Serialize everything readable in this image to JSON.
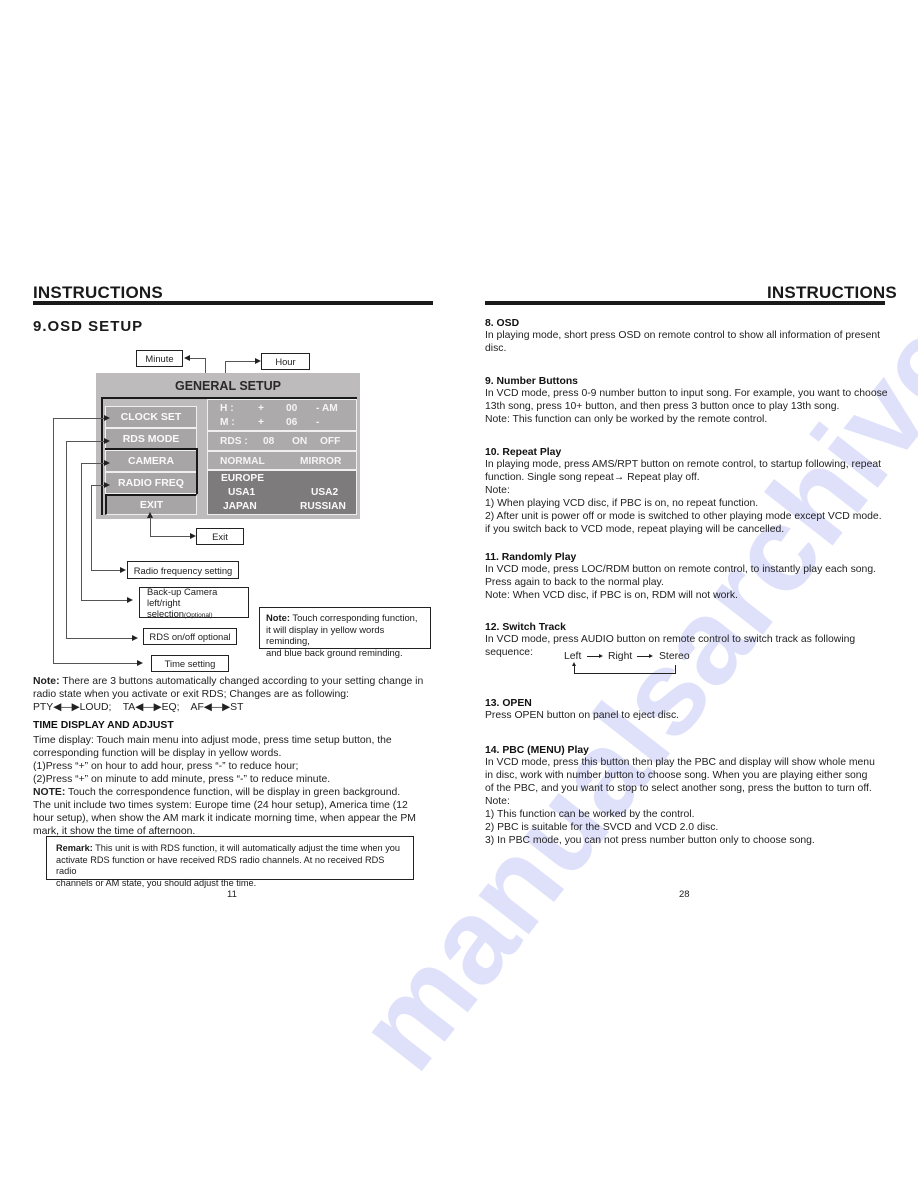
{
  "left_page": {
    "header": "INSTRUCTIONS",
    "section_title": "9.OSD SETUP",
    "diagram": {
      "callouts": {
        "minute": "Minute",
        "hour": "Hour",
        "exit": "Exit",
        "radio_freq": "Radio frequency setting",
        "camera_line1": "Back-up Camera",
        "camera_line2": "left/right selection",
        "camera_optional": "(Optional)",
        "rds": "RDS on/off optional",
        "time": "Time setting"
      },
      "osd": {
        "title": "GENERAL SETUP",
        "menu": [
          "CLOCK SET",
          "RDS MODE",
          "CAMERA",
          "RADIO FREQ",
          "EXIT"
        ],
        "clock": {
          "h_label": "H :",
          "h_plus": "+",
          "h_value": "00",
          "h_ampm": "- AM",
          "m_label": "M :",
          "m_plus": "+",
          "m_value": "06",
          "m_minus": "-"
        },
        "rds": {
          "label": "RDS :",
          "value": "08",
          "on": "ON",
          "off": "OFF"
        },
        "camera": {
          "normal": "NORMAL",
          "mirror": "MIRROR"
        },
        "radio": {
          "europe": "EUROPE",
          "usa1": "USA1",
          "usa2": "USA2",
          "japan": "JAPAN",
          "russian": "RUSSIAN"
        }
      },
      "note_box": {
        "label": "Note:",
        "text1": " Touch corresponding function,",
        "text2": "it will display in yellow words reminding,",
        "text3": "and blue back ground reminding."
      }
    },
    "note": {
      "label": "Note:",
      "text": " There are 3 buttons automatically changed according to your setting change in radio state when you activate or exit RDS; Changes are as following:",
      "pairs": [
        {
          "a": "PTY",
          "b": "LOUD;"
        },
        {
          "a": "TA",
          "b": "EQ;"
        },
        {
          "a": "AF",
          "b": "ST"
        }
      ]
    },
    "time_section": {
      "title": "TIME DISPLAY AND ADJUST",
      "lines": [
        "Time display: Touch main menu into adjust mode, press time setup button, the",
        "corresponding function will be display in yellow words.",
        "(1)Press “+” on hour to add hour, press “-” to reduce hour;",
        "(2)Press “+” on minute to add minute, press “-” to reduce minute."
      ],
      "note_label": "NOTE:",
      "note_text": " Touch the correspondence function, will be display in green background.",
      "tail_lines": [
        "The unit include two times system: Europe time (24 hour setup), America time (12",
        "hour setup), when show the AM mark it indicate morning time, when appear the PM",
        "mark, it show the time of afternoon."
      ]
    },
    "remark": {
      "label": "Remark:",
      "line1": " This unit is with RDS function, it will automatically adjust the time when you",
      "line2": "activate RDS function or have received RDS radio channels. At no received RDS radio",
      "line3": "channels or AM state, you should adjust the time."
    },
    "page_number": "11"
  },
  "right_page": {
    "header": "INSTRUCTIONS",
    "sections": [
      {
        "title": "8. OSD",
        "lines": [
          "In playing mode, short press OSD on remote control to show all information of present",
          "disc."
        ]
      },
      {
        "title": "9. Number Buttons",
        "lines": [
          "In VCD mode, press 0-9 number button to input song. For example, you want to choose",
          "13th  song, press 10+ button, and then press 3 button once to play 13th  song.",
          "Note: This function can only be worked by the remote control."
        ]
      },
      {
        "title": "10. Repeat Play",
        "lines": [
          "In playing mode, press AMS/RPT button on remote control, to startup following, repeat",
          "function.  Single song repeat→ Repeat play off.",
          "Note:",
          "1) When playing VCD disc, if PBC is on, no repeat function.",
          "2) After unit is power off or mode is switched to other playing mode except VCD mode.",
          "if you switch back to VCD mode, repeat playing will be cancelled."
        ]
      },
      {
        "title": "11. Randomly Play",
        "lines": [
          "In VCD mode, press LOC/RDM button on remote control, to instantly play each song.",
          "Press again to back to the normal play.",
          "Note: When VCD disc, if PBC is on, RDM will not work."
        ]
      },
      {
        "title": "12. Switch Track",
        "lines": [
          "In VCD mode, press AUDIO button on remote control to switch track as following",
          "sequence:"
        ]
      },
      {
        "title": "13. OPEN",
        "lines": [
          "Press OPEN button on panel to eject disc."
        ]
      },
      {
        "title": "14. PBC (MENU) Play",
        "lines": [
          "In VCD mode, press this button then play the PBC and display will show whole menu",
          "in disc, work with number button to choose song. When you are playing either song",
          "of the PBC, and you want to stop to select another song, press the button to turn off.",
          "Note:",
          "1)  This function can be worked by the control.",
          "2)  PBC is suitable for the SVCD and VCD 2.0 disc.",
          "3)  In PBC mode, you can not press number button only to choose song."
        ]
      }
    ],
    "track_sequence": [
      "Left",
      "Right",
      "Stereo"
    ],
    "page_number": "28"
  },
  "watermark": "manualsarchive.com"
}
